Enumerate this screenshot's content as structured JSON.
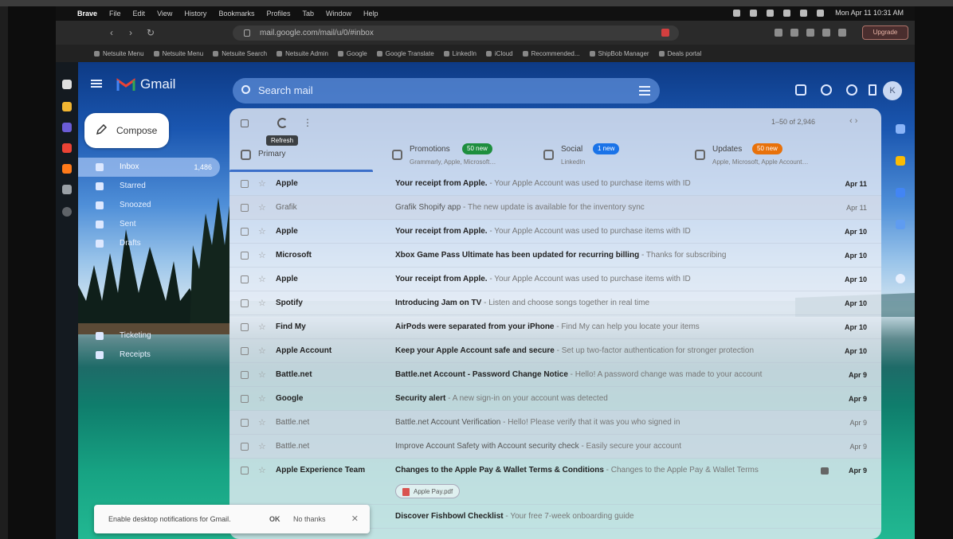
{
  "menubar": {
    "app": "Brave",
    "items": [
      "File",
      "Edit",
      "View",
      "History",
      "Bookmarks",
      "Profiles",
      "Tab",
      "Window",
      "Help"
    ],
    "clock": "Mon Apr 11 10:31 AM"
  },
  "browser": {
    "url": "mail.google.com/mail/u/0/#inbox",
    "upgrade_label": "Upgrade",
    "bookmarks": [
      "Netsuite Menu",
      "Netsuite Menu",
      "Netsuite Search",
      "Netsuite Admin",
      "Google",
      "Google Translate",
      "LinkedIn",
      "iCloud",
      "Recommended...",
      "ShipBob Manager",
      "Deals portal"
    ]
  },
  "gmail": {
    "logo_text": "Gmail",
    "search_placeholder": "Search mail",
    "avatar_letter": "K",
    "compose_label": "Compose",
    "nav": [
      {
        "label": "Inbox",
        "count": "1,486",
        "active": true
      },
      {
        "label": "Starred",
        "count": ""
      },
      {
        "label": "Snoozed",
        "count": ""
      },
      {
        "label": "Sent",
        "count": ""
      },
      {
        "label": "Drafts",
        "count": ""
      }
    ],
    "nav_lower": [
      {
        "label": "Ticketing"
      },
      {
        "label": "Receipts"
      }
    ],
    "toolbar": {
      "tooltip": "Refresh",
      "pager": "1–50 of 2,946"
    },
    "tabs": [
      {
        "label": "Primary",
        "badge": "",
        "sub": ""
      },
      {
        "label": "Promotions",
        "badge": "50 new",
        "badge_color": "#1e8e3e",
        "sub": "Grammarly, Apple, Microsoft…"
      },
      {
        "label": "Social",
        "badge": "1 new",
        "badge_color": "#1a73e8",
        "sub": "LinkedIn"
      },
      {
        "label": "Updates",
        "badge": "50 new",
        "badge_color": "#e8710a",
        "sub": "Apple, Microsoft, Apple Account…"
      }
    ],
    "rows": [
      {
        "sender": "Apple",
        "subject": "Your receipt from Apple.",
        "snippet": " - Your Apple Account was used to purchase items with ID",
        "date": "Apr 11",
        "read": false
      },
      {
        "sender": "Grafik",
        "subject": "Grafik Shopify app",
        "snippet": " - The new update is available for the inventory sync",
        "date": "Apr 11",
        "read": true
      },
      {
        "sender": "Apple",
        "subject": "Your receipt from Apple.",
        "snippet": " - Your Apple Account was used to purchase items with ID",
        "date": "Apr 10",
        "read": false
      },
      {
        "sender": "Microsoft",
        "subject": "Xbox Game Pass Ultimate has been updated for recurring billing",
        "snippet": " - Thanks for subscribing",
        "date": "Apr 10",
        "read": false
      },
      {
        "sender": "Apple",
        "subject": "Your receipt from Apple.",
        "snippet": " - Your Apple Account was used to purchase items with ID",
        "date": "Apr 10",
        "read": false
      },
      {
        "sender": "Spotify",
        "subject": "Introducing Jam on TV",
        "snippet": " - Listen and choose songs together in real time",
        "date": "Apr 10",
        "read": false
      },
      {
        "sender": "Find My",
        "subject": "AirPods were separated from your iPhone",
        "snippet": " - Find My can help you locate your items",
        "date": "Apr 10",
        "read": false
      },
      {
        "sender": "Apple Account",
        "subject": "Keep your Apple Account safe and secure",
        "snippet": " - Set up two-factor authentication for stronger protection",
        "date": "Apr 10",
        "read": false
      },
      {
        "sender": "Battle.net",
        "subject": "Battle.net Account - Password Change Notice",
        "snippet": " - Hello! A password change was made to your account",
        "date": "Apr 9",
        "read": false
      },
      {
        "sender": "Google",
        "subject": "Security alert",
        "snippet": " - A new sign-in on your account was detected",
        "date": "Apr 9",
        "read": false
      },
      {
        "sender": "Battle.net",
        "subject": "Battle.net Account Verification",
        "snippet": " - Hello! Please verify that it was you who signed in",
        "date": "Apr 9",
        "read": true
      },
      {
        "sender": "Battle.net",
        "subject": "Improve Account Safety with Account security check",
        "snippet": " - Easily secure your account",
        "date": "Apr 9",
        "read": true
      },
      {
        "sender": "Apple Experience Team",
        "subject": "Changes to the Apple Pay & Wallet Terms & Conditions",
        "snippet": " - Changes to the Apple Pay & Wallet Terms",
        "date": "Apr 9",
        "read": false,
        "tall": true,
        "chip": "Apple Pay.pdf"
      },
      {
        "sender": "",
        "subject": "Discover Fishbowl Checklist",
        "snippet": " - Your free 7-week onboarding guide",
        "date": "",
        "read": false
      }
    ],
    "snackbar": {
      "text": "Enable desktop notifications for Gmail.",
      "ok": "OK",
      "no_thanks": "No thanks"
    }
  }
}
